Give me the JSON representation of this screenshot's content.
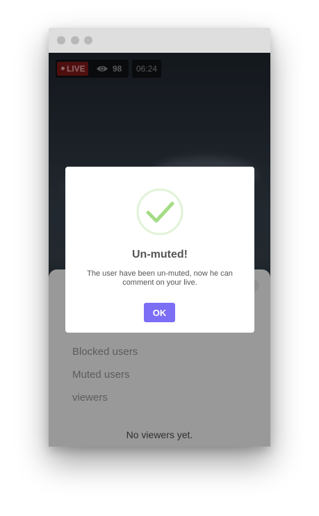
{
  "stream": {
    "live_label": "LIVE",
    "viewer_count": "98",
    "duration": "06:24"
  },
  "sheet": {
    "items": [
      "Blocked users",
      "Muted users",
      "viewers"
    ],
    "empty_text": "No viewers yet."
  },
  "dialog": {
    "title": "Un-muted!",
    "message": "The user have been un-muted, now he can comment on your live.",
    "ok_label": "OK"
  },
  "colors": {
    "accent": "#7c6ef5",
    "success": "#a5dc86",
    "live": "#8b1a1a"
  },
  "icons": {
    "viewers": "eye-icon",
    "success": "check-icon"
  }
}
